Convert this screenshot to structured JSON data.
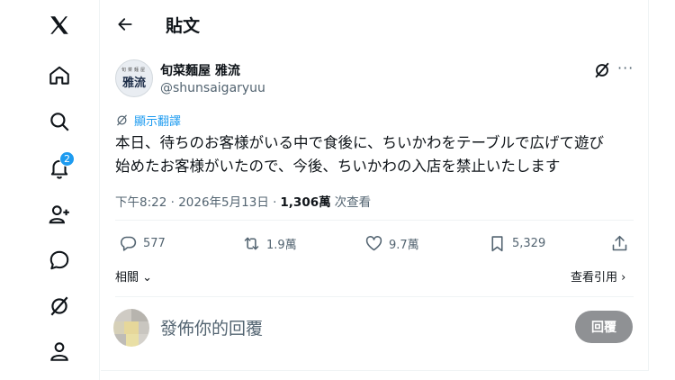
{
  "nav": {
    "notifications_badge": "2",
    "items": [
      "x-logo",
      "home",
      "search",
      "notifications",
      "people",
      "messages",
      "grok",
      "profile"
    ]
  },
  "header": {
    "title": "貼文"
  },
  "post": {
    "display_name": "旬菜麵屋 雅流",
    "handle": "@shunsaigaryuu",
    "avatar_text_small": "旬菜麵屋",
    "avatar_text_big": "雅流",
    "translate_label": "顯示翻譯",
    "body_line1": "本日、待ちのお客様がいる中で食後に、ちいかわをテーブルで広げて遊び",
    "body_line2": "始めたお客様がいたので、今後、ちいかわの入店を禁止いたします",
    "timestamp": "下午8:22 · 2026年5月13日 ·",
    "views_count": "1,306萬",
    "views_label": "次查看"
  },
  "actions": {
    "replies": "577",
    "reposts": "1.9萬",
    "likes": "9.7萬",
    "bookmarks": "5,329"
  },
  "links": {
    "related": "相關",
    "view_quotes": "查看引用"
  },
  "reply_box": {
    "placeholder": "發佈你的回覆",
    "button": "回覆"
  },
  "colors": {
    "accent": "#1d9bf0",
    "text_primary": "#0f1419",
    "text_secondary": "#536471",
    "reply_button_bg": "#8f9194"
  }
}
